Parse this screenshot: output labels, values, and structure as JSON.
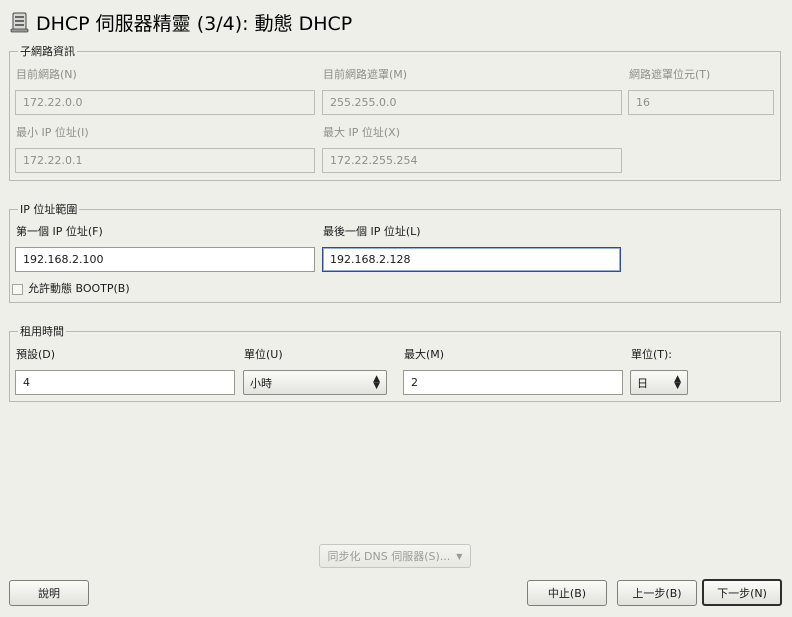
{
  "window": {
    "title": "DHCP 伺服器精靈 (3/4): 動態 DHCP",
    "icon": "server-icon"
  },
  "subnet": {
    "legend": "子網路資訊",
    "current_network": {
      "label": "目前網路(N)",
      "value": "172.22.0.0"
    },
    "current_netmask": {
      "label": "目前網路遮罩(M)",
      "value": "255.255.0.0"
    },
    "netmask_bits": {
      "label": "網路遮罩位元(T)",
      "value": "16"
    },
    "min_ip": {
      "label": "最小 IP 位址(I)",
      "value": "172.22.0.1"
    },
    "max_ip": {
      "label": "最大 IP 位址(X)",
      "value": "172.22.255.254"
    }
  },
  "ip_range": {
    "legend": "IP 位址範圍",
    "first_ip": {
      "label": "第一個 IP 位址(F)",
      "value": "192.168.2.100"
    },
    "last_ip": {
      "label": "最後一個 IP 位址(L)",
      "value": "192.168.2.128"
    },
    "bootp": {
      "label": "允許動態 BOOTP(B)",
      "checked": false
    }
  },
  "lease": {
    "legend": "租用時間",
    "default": {
      "label": "預設(D)",
      "value": "4"
    },
    "default_unit": {
      "label": "單位(U)",
      "value": "小時"
    },
    "max": {
      "label": "最大(M)",
      "value": "2"
    },
    "max_unit": {
      "label": "單位(T):",
      "value": "日"
    }
  },
  "sync_dns_button": "同步化 DNS 伺服器(S)...",
  "buttons": {
    "help": "說明",
    "abort": "中止(B)",
    "back": "上一步(B)",
    "next": "下一步(N)"
  },
  "colors": {
    "background": "#efefe9",
    "focus_border": "#2f4e86"
  }
}
